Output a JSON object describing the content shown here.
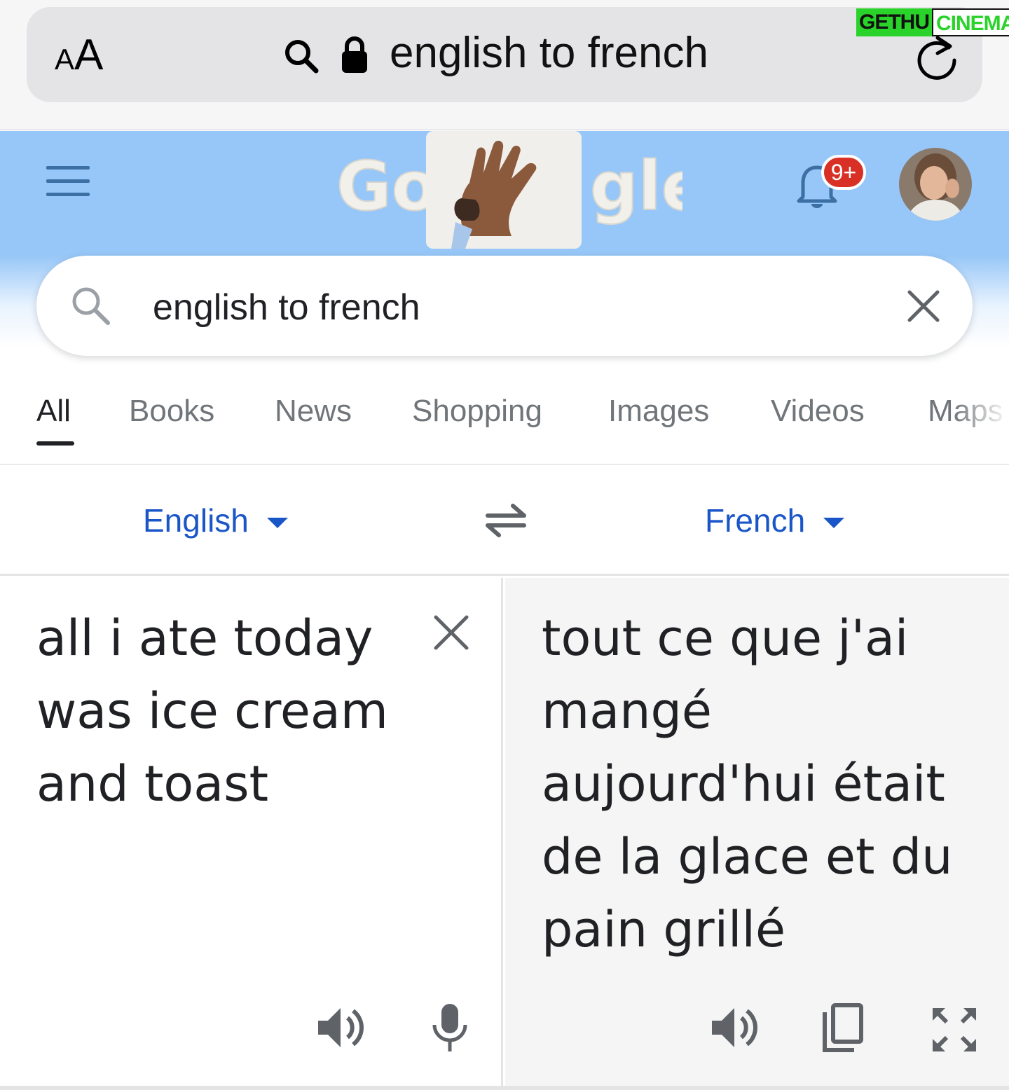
{
  "browser": {
    "text_size_label_small": "A",
    "text_size_label_big": "A",
    "address": "english to french"
  },
  "watermark": {
    "part1": "GETHU",
    "part2": "CINEMA"
  },
  "header": {
    "notification_badge": "9+",
    "doodle_letters_left": "Go",
    "doodle_letters_right": "gle"
  },
  "search": {
    "query": "english to french"
  },
  "tabs": [
    {
      "label": "All",
      "active": true
    },
    {
      "label": "Books"
    },
    {
      "label": "News"
    },
    {
      "label": "Shopping"
    },
    {
      "label": "Images"
    },
    {
      "label": "Videos"
    },
    {
      "label": "Maps"
    }
  ],
  "translator": {
    "source_language": "English",
    "target_language": "French",
    "source_text": "all i ate today was ice cream and toast",
    "translated_text": "tout ce que j'ai mangé aujourd'hui était de la glace et du pain grillé"
  },
  "colors": {
    "header_blue": "#97c7f8",
    "link_blue": "#1a56c8",
    "badge_red": "#d93025"
  }
}
